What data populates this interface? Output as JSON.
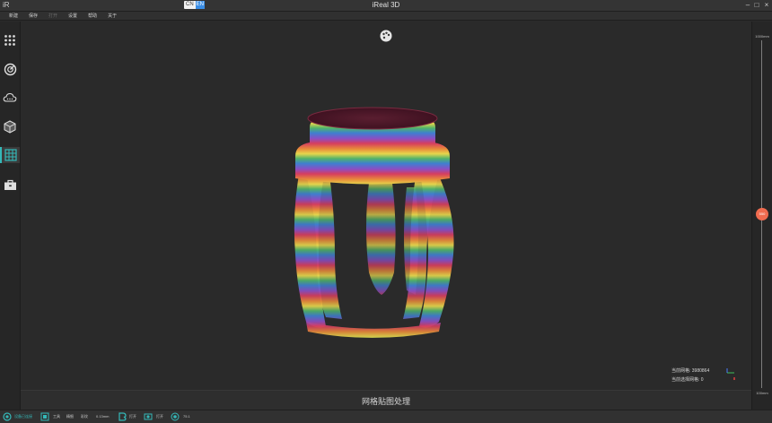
{
  "app": {
    "logo_text": "iR",
    "title": "iReal 3D",
    "lang_switch": {
      "left": "CN",
      "right": "EN"
    },
    "window_controls": [
      "–",
      "□",
      "×"
    ]
  },
  "menu": {
    "items": [
      {
        "label": "新建",
        "enabled": true
      },
      {
        "label": "保存",
        "enabled": true
      },
      {
        "label": "打开",
        "enabled": false
      },
      {
        "label": "设置",
        "enabled": true
      },
      {
        "label": "帮助",
        "enabled": true
      },
      {
        "label": "关于",
        "enabled": true
      }
    ]
  },
  "sidebar": {
    "items": [
      {
        "icon": "grid-dots-icon",
        "active": false
      },
      {
        "icon": "scan-target-icon",
        "active": false
      },
      {
        "icon": "cloud-points-icon",
        "active": false
      },
      {
        "icon": "cube-mesh-icon",
        "active": false
      },
      {
        "icon": "mesh-grid-icon",
        "active": true
      },
      {
        "icon": "toolbox-icon",
        "active": false
      }
    ]
  },
  "viewport": {
    "toolbar_icon": "palette-icon",
    "stats": {
      "current_mesh_label": "当前网格:",
      "current_mesh_value": "3980864",
      "selected_mesh_label": "当前选择网格:",
      "selected_mesh_value": "0"
    },
    "caption": "网格贴图处理"
  },
  "slider": {
    "top_label": "1000mm",
    "bottom_label": "100mm",
    "knob_label": "550",
    "level": 0.5
  },
  "statusbar": {
    "device": "设备已连接",
    "mode_items": [
      "工具",
      "精细",
      "彩纹",
      "0.13mm"
    ],
    "toggle1": "打开",
    "toggle2": "打开",
    "toggle3": "75.1"
  },
  "colors": {
    "accent_teal": "#34b8b8",
    "slider_knob": "#f06b4f",
    "background": "#2a2a2a"
  }
}
